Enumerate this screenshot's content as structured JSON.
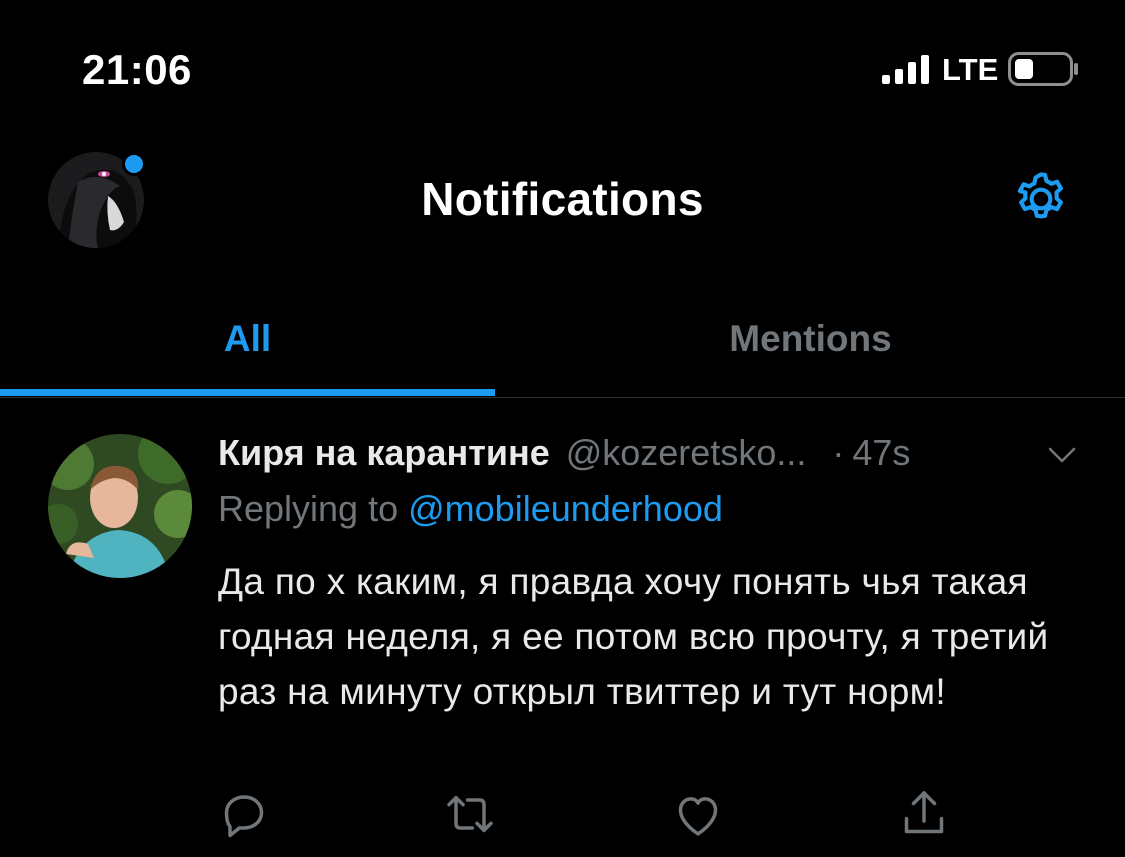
{
  "status_bar": {
    "time": "21:06",
    "network": "LTE"
  },
  "header": {
    "title": "Notifications"
  },
  "tabs": [
    {
      "label": "All",
      "active": true
    },
    {
      "label": "Mentions",
      "active": false
    }
  ],
  "tweet": {
    "display_name": "Киря на карантине",
    "handle": "@kozeretsko...",
    "separator": "·",
    "time": "47s",
    "replying_prefix": "Replying to",
    "replying_to": "@mobileunderhood",
    "text": "Да по х каким, я правда хочу понять чья такая годная неделя, я ее потом всю прочту, я третий раз на минуту открыл твиттер и тут норм!"
  },
  "icons": [
    "signal-icon",
    "battery-icon",
    "gear-icon",
    "chevron-down-icon",
    "reply-icon",
    "retweet-icon",
    "like-icon",
    "share-icon"
  ],
  "colors": {
    "accent": "#1d9bf0",
    "background": "#000000",
    "muted": "#71767b"
  }
}
